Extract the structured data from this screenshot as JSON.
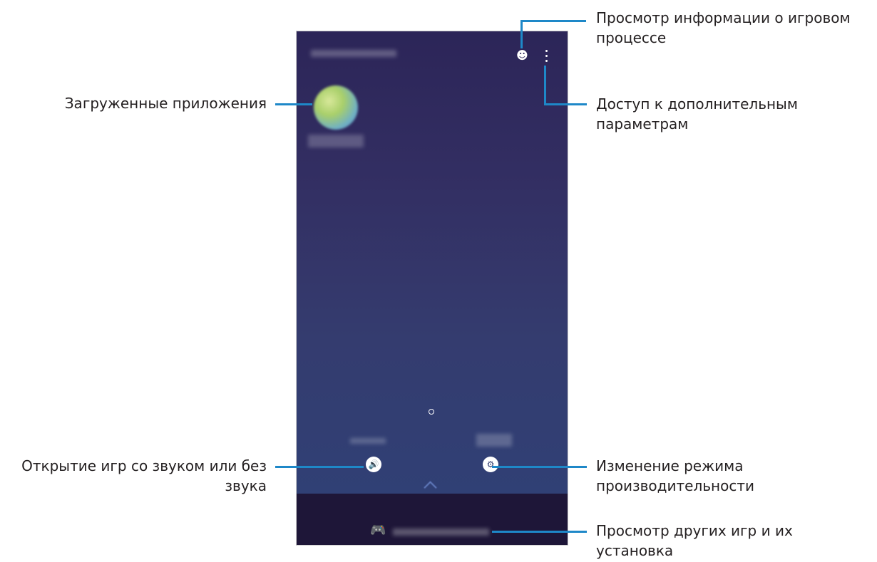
{
  "callouts": {
    "game_info": "Просмотр информации о игровом процессе",
    "game_info_l1": "Просмотр информации о игровом",
    "game_info_l2": "процессе",
    "more_options_l1": "Доступ к дополнительным",
    "more_options_l2": "параметрам",
    "downloaded_apps": "Загруженные приложения",
    "mute_l1": "Открытие игр со звуком или без",
    "mute_l2": "звука",
    "performance_l1": "Изменение режима",
    "performance_l2": "производительности",
    "discover_l1": "Просмотр других игр и их",
    "discover_l2": "установка"
  },
  "icons": {
    "profile": "person-icon",
    "more": "more-options-icon",
    "sound": "speaker-icon",
    "performance": "performance-icon",
    "discover": "gamepad-icon",
    "chevron": "chevron-up-icon",
    "page_indicator": "page-indicator-icon"
  },
  "colors": {
    "callout_line": "#1e88c8",
    "screen_top": "#2c2558",
    "screen_bottom": "#2f4177",
    "bottom_bar": "#1e1638"
  }
}
